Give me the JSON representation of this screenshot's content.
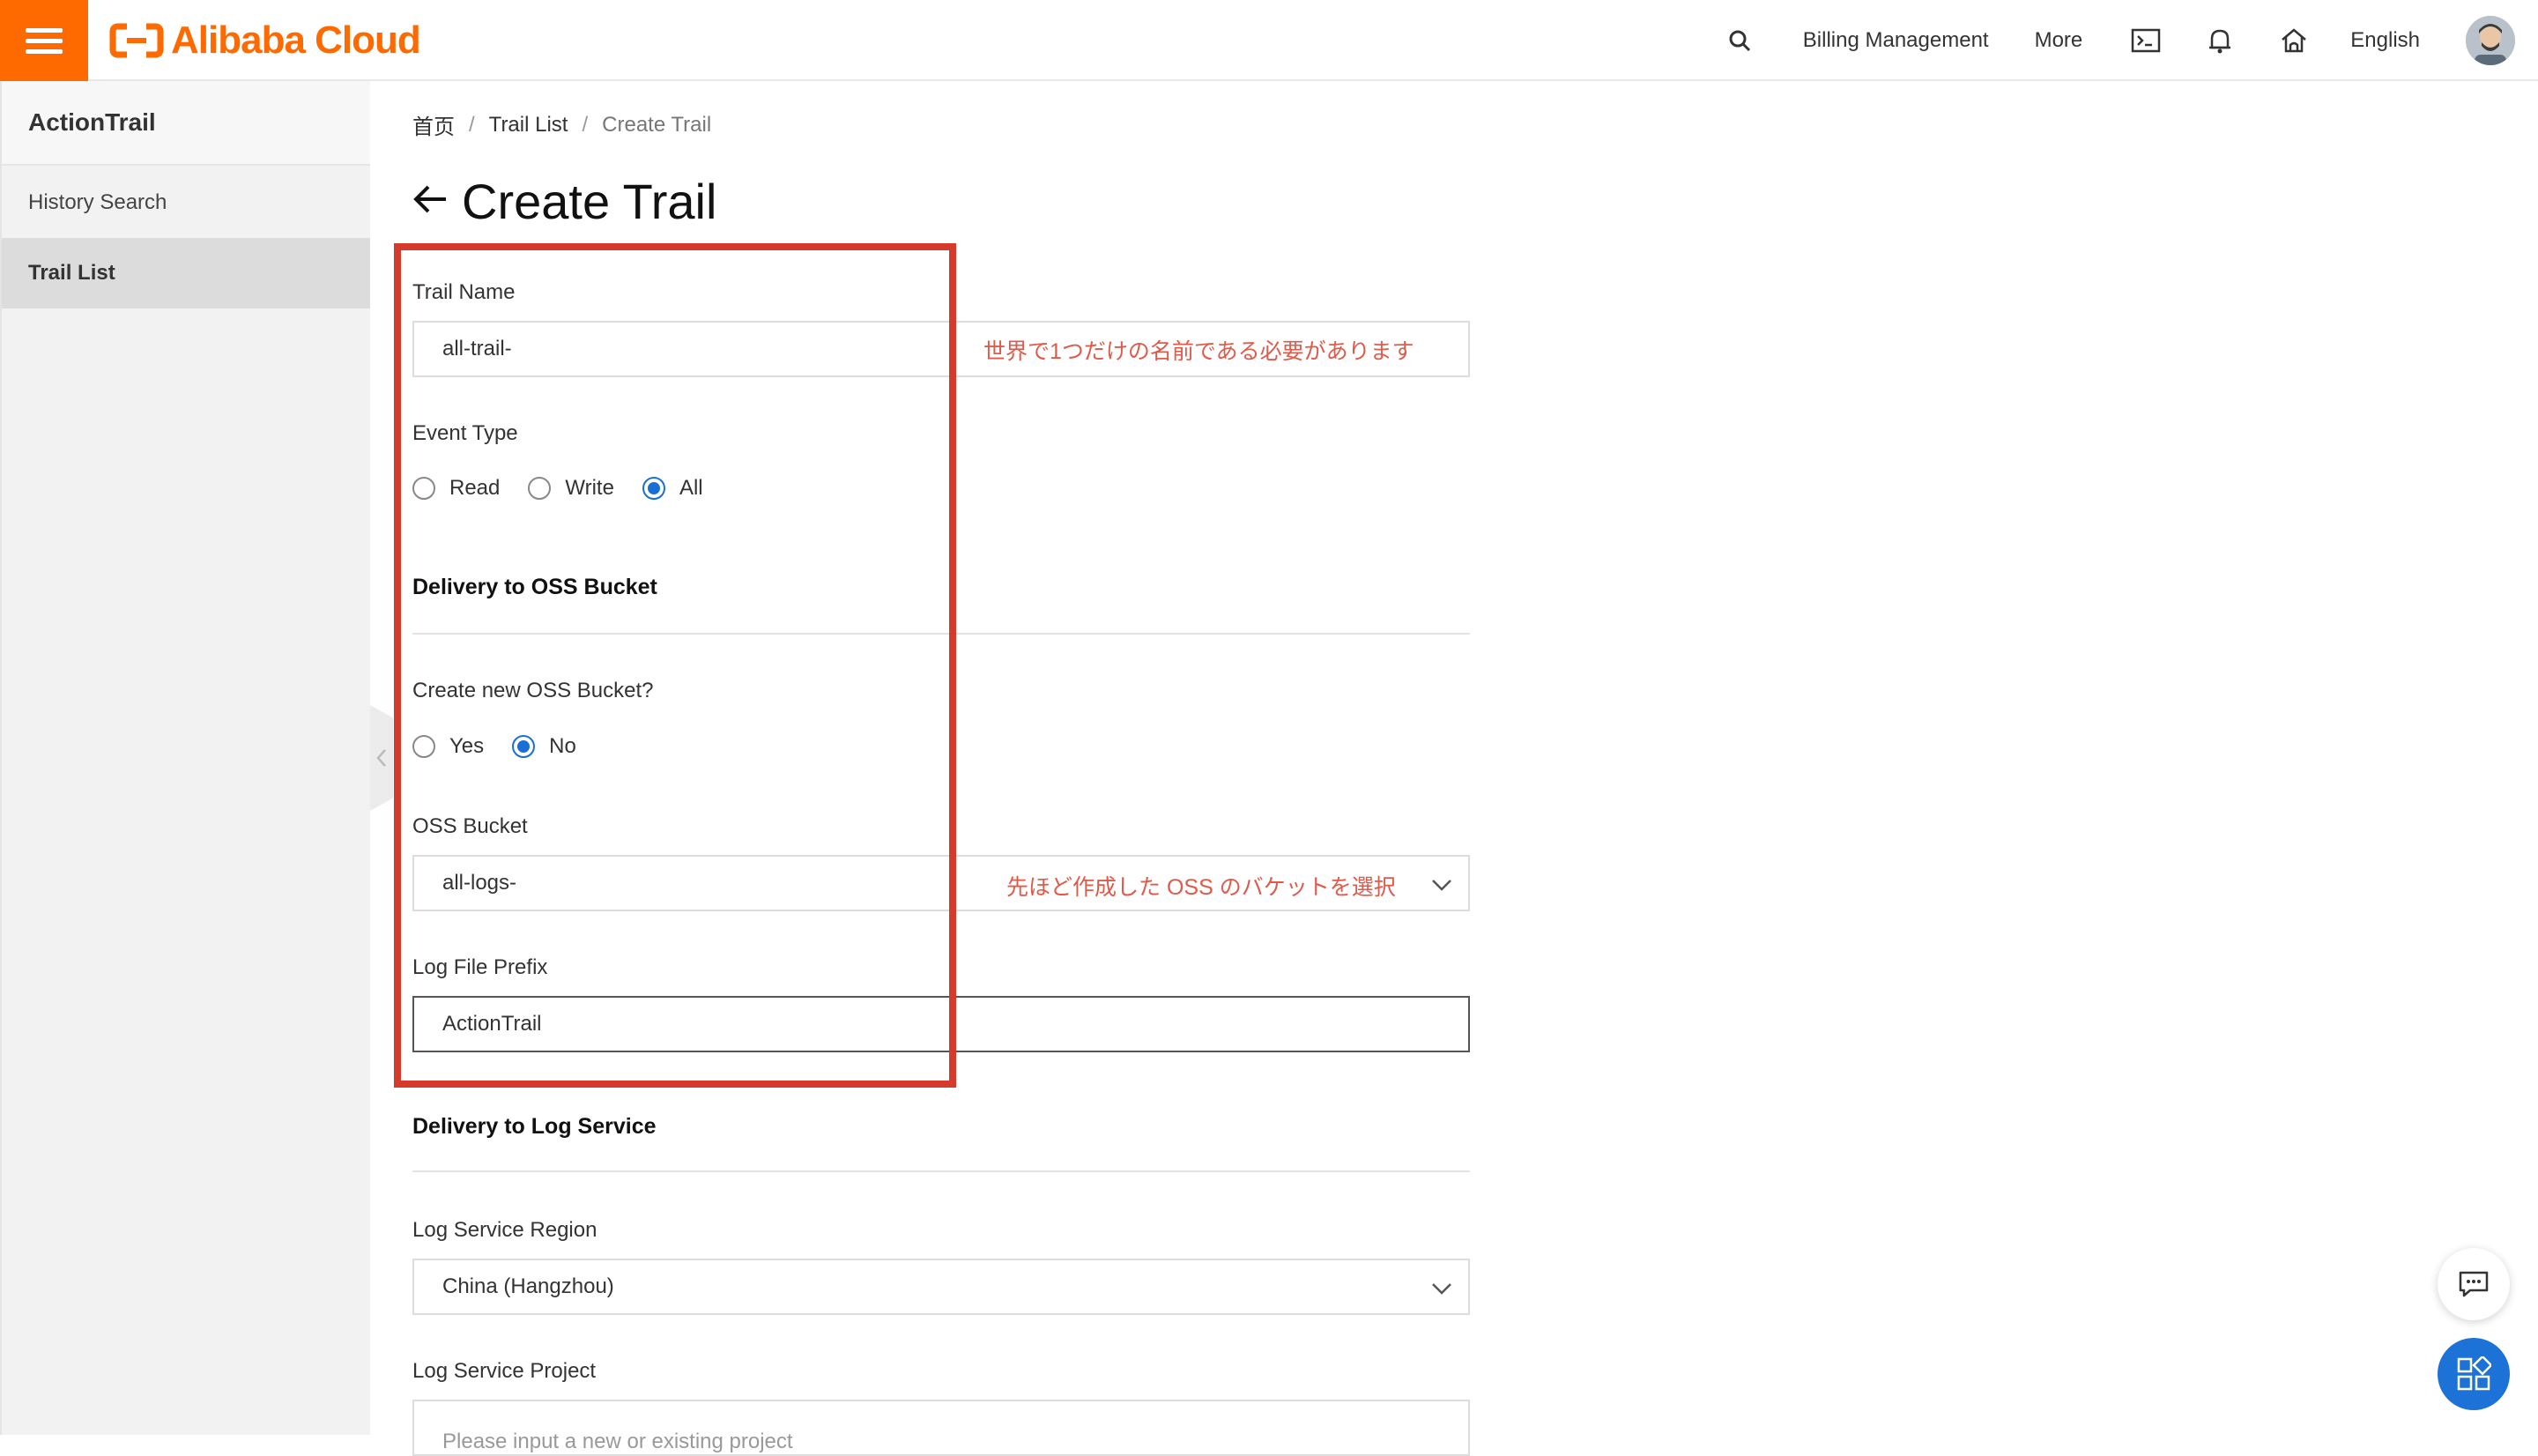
{
  "brand": {
    "logo_text": "Alibaba Cloud",
    "accent_color": "#ff6a00"
  },
  "header": {
    "billing": "Billing Management",
    "more": "More",
    "language": "English",
    "icons": [
      "search-icon",
      "terminal-icon",
      "bell-icon",
      "home-icon",
      "avatar"
    ]
  },
  "sidebar": {
    "title": "ActionTrail",
    "items": [
      {
        "label": "History Search",
        "active": false
      },
      {
        "label": "Trail List",
        "active": true
      }
    ]
  },
  "breadcrumb": {
    "home": "首页",
    "list": "Trail List",
    "current": "Create Trail"
  },
  "page": {
    "title": "Create Trail"
  },
  "form": {
    "trail_name": {
      "label": "Trail Name",
      "value": "all-trail-",
      "annotation": "世界で1つだけの名前である必要があります"
    },
    "event_type": {
      "label": "Event Type",
      "options": [
        "Read",
        "Write",
        "All"
      ],
      "selected": "All"
    },
    "oss_section": "Delivery to OSS Bucket",
    "create_bucket": {
      "label": "Create new OSS Bucket?",
      "options": [
        "Yes",
        "No"
      ],
      "selected": "No"
    },
    "oss_bucket": {
      "label": "OSS Bucket",
      "value": "all-logs-",
      "annotation": "先ほど作成した OSS のバケットを選択"
    },
    "log_prefix": {
      "label": "Log File Prefix",
      "value": "ActionTrail"
    },
    "log_section": "Delivery to Log Service",
    "log_region": {
      "label": "Log Service Region",
      "value": "China (Hangzhou)"
    },
    "log_project": {
      "label": "Log Service Project",
      "placeholder": "Please input a new or existing project"
    }
  },
  "colors": {
    "annotation": "#e05a4a",
    "highlight_border": "#d63a2a",
    "radio_checked": "#1a6fd6"
  }
}
